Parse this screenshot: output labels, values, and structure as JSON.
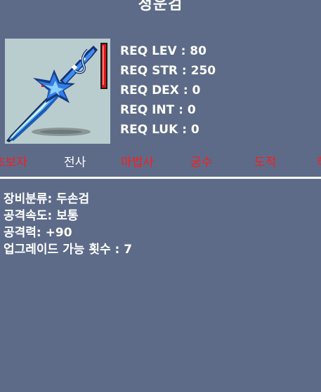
{
  "item": {
    "name": "청운검",
    "icon": "blue-two-handed-sword-icon"
  },
  "requirements": [
    {
      "label": "REQ LEV",
      "value": "80",
      "text": "REQ LEV : 80"
    },
    {
      "label": "REQ STR",
      "value": "250",
      "text": "REQ STR : 250"
    },
    {
      "label": "REQ DEX",
      "value": "0",
      "text": "REQ DEX : 0"
    },
    {
      "label": "REQ INT",
      "value": "0",
      "text": "REQ INT : 0"
    },
    {
      "label": "REQ LUK",
      "value": "0",
      "text": "REQ LUK : 0"
    }
  ],
  "jobs": [
    {
      "name": "초보자",
      "allowed": false
    },
    {
      "name": "전사",
      "allowed": true
    },
    {
      "name": "마법사",
      "allowed": false
    },
    {
      "name": "궁수",
      "allowed": false
    },
    {
      "name": "도적",
      "allowed": false
    },
    {
      "name": "해적",
      "allowed": false
    }
  ],
  "stats": [
    "장비분류: 두손검",
    "공격속도: 보통",
    "공격력: +90",
    "업그레이드 가능 횟수 : 7"
  ],
  "colors": {
    "background": "#5d6b89",
    "icon_background": "#b9cdcf",
    "text": "#ffffff",
    "job_allowed": "#ffffff",
    "job_denied": "#ff1a1a"
  }
}
